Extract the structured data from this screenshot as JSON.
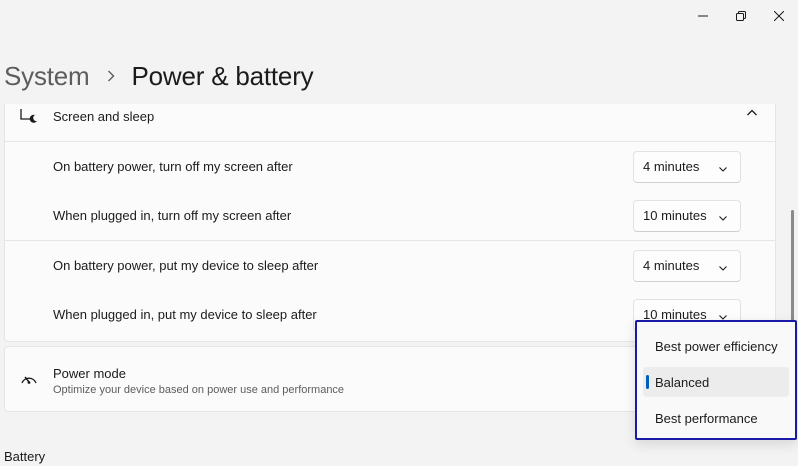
{
  "window": {
    "controls": [
      "minimize",
      "restore",
      "close"
    ]
  },
  "breadcrumb": {
    "parent": "System",
    "current": "Power & battery"
  },
  "screen_sleep": {
    "title": "Screen and sleep",
    "rows": [
      {
        "label": "On battery power, turn off my screen after",
        "value": "4 minutes"
      },
      {
        "label": "When plugged in, turn off my screen after",
        "value": "10 minutes"
      },
      {
        "label": "On battery power, put my device to sleep after",
        "value": "4 minutes"
      },
      {
        "label": "When plugged in, put my device to sleep after",
        "value": "10 minutes"
      }
    ]
  },
  "power_mode": {
    "title": "Power mode",
    "subtitle": "Optimize your device based on power use and performance",
    "options": [
      "Best power efficiency",
      "Balanced",
      "Best performance"
    ],
    "selected": "Balanced"
  },
  "battery_section": {
    "label": "Battery"
  },
  "colors": {
    "accent": "#005fb8",
    "popup_border": "#1a1aa8",
    "background": "#f3f3f3",
    "card": "#fbfbfb"
  }
}
